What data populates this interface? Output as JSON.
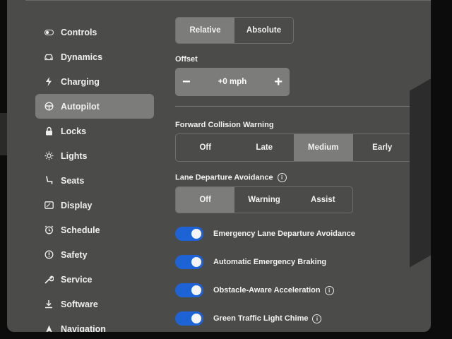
{
  "sidebar": {
    "items": [
      {
        "label": "Controls",
        "icon": "toggle-icon",
        "active": false
      },
      {
        "label": "Dynamics",
        "icon": "car-icon",
        "active": false
      },
      {
        "label": "Charging",
        "icon": "bolt-icon",
        "active": false
      },
      {
        "label": "Autopilot",
        "icon": "steering-wheel-icon",
        "active": true
      },
      {
        "label": "Locks",
        "icon": "lock-icon",
        "active": false
      },
      {
        "label": "Lights",
        "icon": "sun-icon",
        "active": false
      },
      {
        "label": "Seats",
        "icon": "seat-icon",
        "active": false
      },
      {
        "label": "Display",
        "icon": "display-icon",
        "active": false
      },
      {
        "label": "Schedule",
        "icon": "alarm-icon",
        "active": false
      },
      {
        "label": "Safety",
        "icon": "alert-circle-icon",
        "active": false
      },
      {
        "label": "Service",
        "icon": "wrench-icon",
        "active": false
      },
      {
        "label": "Software",
        "icon": "download-icon",
        "active": false
      },
      {
        "label": "Navigation",
        "icon": "navigation-icon",
        "active": false
      }
    ]
  },
  "speed_mode": {
    "options": [
      "Relative",
      "Absolute"
    ],
    "selected": "Relative"
  },
  "offset": {
    "label": "Offset",
    "value": "+0 mph",
    "minus": "−",
    "plus": "+"
  },
  "fcw": {
    "label": "Forward Collision Warning",
    "options": [
      "Off",
      "Late",
      "Medium",
      "Early"
    ],
    "selected": "Medium"
  },
  "lda": {
    "label": "Lane Departure Avoidance",
    "info": "i",
    "options": [
      "Off",
      "Warning",
      "Assist"
    ],
    "selected": "Off"
  },
  "toggles": [
    {
      "label": "Emergency Lane Departure Avoidance",
      "on": true,
      "info": false
    },
    {
      "label": "Automatic Emergency Braking",
      "on": true,
      "info": false
    },
    {
      "label": "Obstacle-Aware Acceleration",
      "on": true,
      "info": true
    },
    {
      "label": "Green Traffic Light Chime",
      "on": true,
      "info": true
    }
  ],
  "colors": {
    "toggle_on": "#1e63d6",
    "selected": "#7c7d7a",
    "background": "#4b4c4a"
  }
}
